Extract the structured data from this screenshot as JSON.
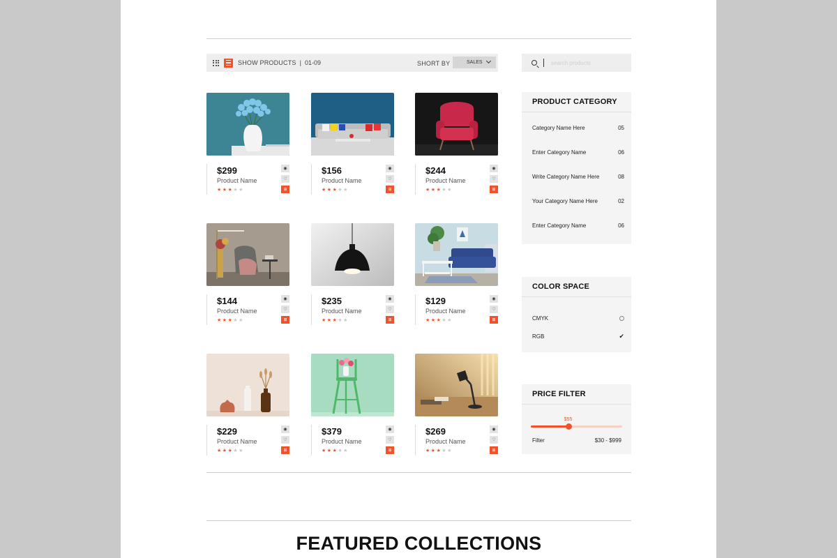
{
  "toolbar": {
    "show_products_label": "SHOW PRODUCTS",
    "separator": "|",
    "range": "01-09",
    "sort_label": "SHORT BY",
    "sort_value": "SALES"
  },
  "search": {
    "placeholder": "search products"
  },
  "products": [
    {
      "price": "$299",
      "name": "Product Name",
      "rating": 3,
      "image": "blue-flowers-vase"
    },
    {
      "price": "$156",
      "name": "Product Name",
      "rating": 3,
      "image": "sofa-blue-wall"
    },
    {
      "price": "$244",
      "name": "Product Name",
      "rating": 3,
      "image": "pink-armchair"
    },
    {
      "price": "$144",
      "name": "Product Name",
      "rating": 3,
      "image": "lounge-chair"
    },
    {
      "price": "$235",
      "name": "Product Name",
      "rating": 3,
      "image": "pendant-lamp"
    },
    {
      "price": "$129",
      "name": "Product Name",
      "rating": 3,
      "image": "blue-sofa-room"
    },
    {
      "price": "$229",
      "name": "Product Name",
      "rating": 3,
      "image": "vases-shelf"
    },
    {
      "price": "$379",
      "name": "Product Name",
      "rating": 3,
      "image": "green-stool"
    },
    {
      "price": "$269",
      "name": "Product Name",
      "rating": 3,
      "image": "desk-lamp"
    }
  ],
  "product_category": {
    "title": "PRODUCT CATEGORY",
    "items": [
      {
        "label": "Category Name Here",
        "count": "05"
      },
      {
        "label": "Enter Category Name",
        "count": "06"
      },
      {
        "label": "Write Category Name Here",
        "count": "08"
      },
      {
        "label": "Your Category Name Here",
        "count": "02"
      },
      {
        "label": "Enter Category Name",
        "count": "06"
      }
    ]
  },
  "color_space": {
    "title": "COLOR SPACE",
    "options": [
      {
        "label": "CMYK",
        "selected": false
      },
      {
        "label": "RGB",
        "selected": true
      }
    ]
  },
  "price_filter": {
    "title": "PRICE FILTER",
    "current": "$55",
    "position": 0.41,
    "label": "Filter",
    "range": "$30 - $999"
  },
  "featured": {
    "title": "FEATURED COLLECTIONS"
  },
  "colors": {
    "accent": "#f0532b",
    "panel": "#f4f4f4",
    "toolbar": "#eeeeee"
  }
}
